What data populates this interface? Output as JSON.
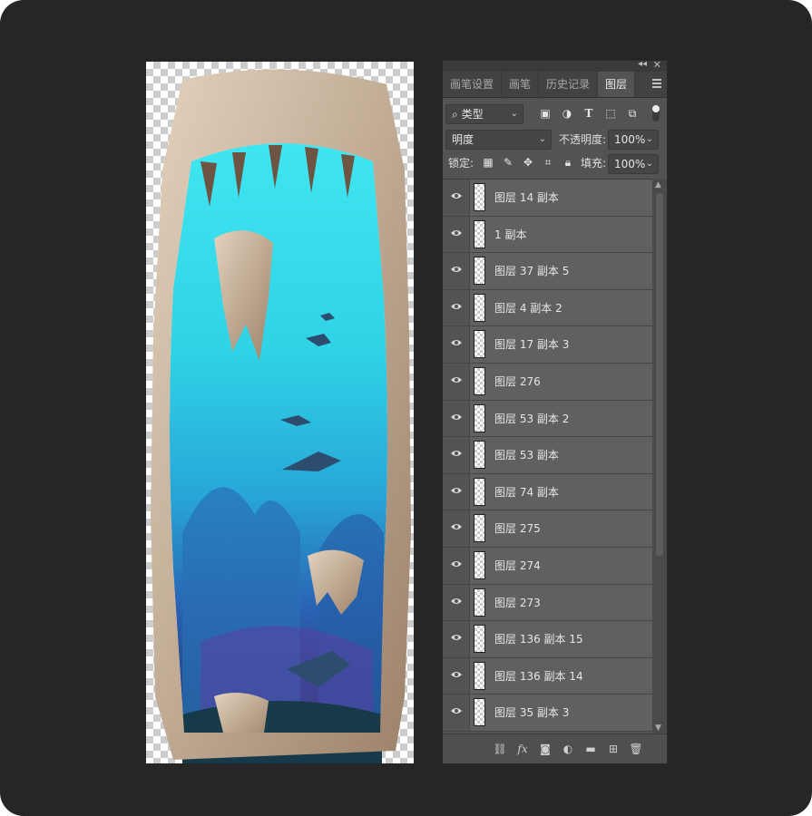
{
  "panel": {
    "collapse_glyph": "◂◂",
    "close_glyph": "✕",
    "tabs": [
      {
        "label": "画笔设置"
      },
      {
        "label": "画笔"
      },
      {
        "label": "历史记录"
      },
      {
        "label": "图层"
      }
    ],
    "active_tab": "图层",
    "filter": {
      "search_glyph": "⌕",
      "value": "类型"
    },
    "blend_mode": "明度",
    "opacity_label": "不透明度:",
    "opacity_value": "100%",
    "lock_label": "锁定:",
    "fill_label": "填充:",
    "fill_value": "100%",
    "layers": [
      {
        "name": "图层 14 副本"
      },
      {
        "name": "1 副本"
      },
      {
        "name": "图层 37 副本 5"
      },
      {
        "name": "图层 4 副本 2"
      },
      {
        "name": "图层 17 副本 3"
      },
      {
        "name": "图层 276"
      },
      {
        "name": "图层 53 副本 2"
      },
      {
        "name": "图层 53 副本"
      },
      {
        "name": "图层 74 副本"
      },
      {
        "name": "图层 275"
      },
      {
        "name": "图层 274"
      },
      {
        "name": "图层 273"
      },
      {
        "name": "图层 136 副本 15"
      },
      {
        "name": "图层 136 副本 14"
      },
      {
        "name": "图层 35 副本 3"
      }
    ],
    "filter_icons": [
      "image-filter-icon",
      "adjustment-filter-icon",
      "type-filter-icon",
      "shape-filter-icon",
      "smart-object-filter-icon"
    ],
    "lock_icons": [
      "lock-transparent-pixels-icon",
      "lock-image-pixels-icon",
      "lock-position-icon",
      "lock-artboard-icon",
      "lock-all-icon"
    ],
    "bottom_icons": [
      "link-layers-icon",
      "fx-icon",
      "mask-icon",
      "adjustment-layer-icon",
      "group-folder-icon",
      "new-layer-icon",
      "trash-icon"
    ],
    "fx_label": "fx"
  },
  "colors": {
    "app_background": "#262626",
    "panel_background": "#535353",
    "water_light": "#33d8ea",
    "water_deep": "#1f6fb8",
    "rock": "#cdb9a1"
  }
}
